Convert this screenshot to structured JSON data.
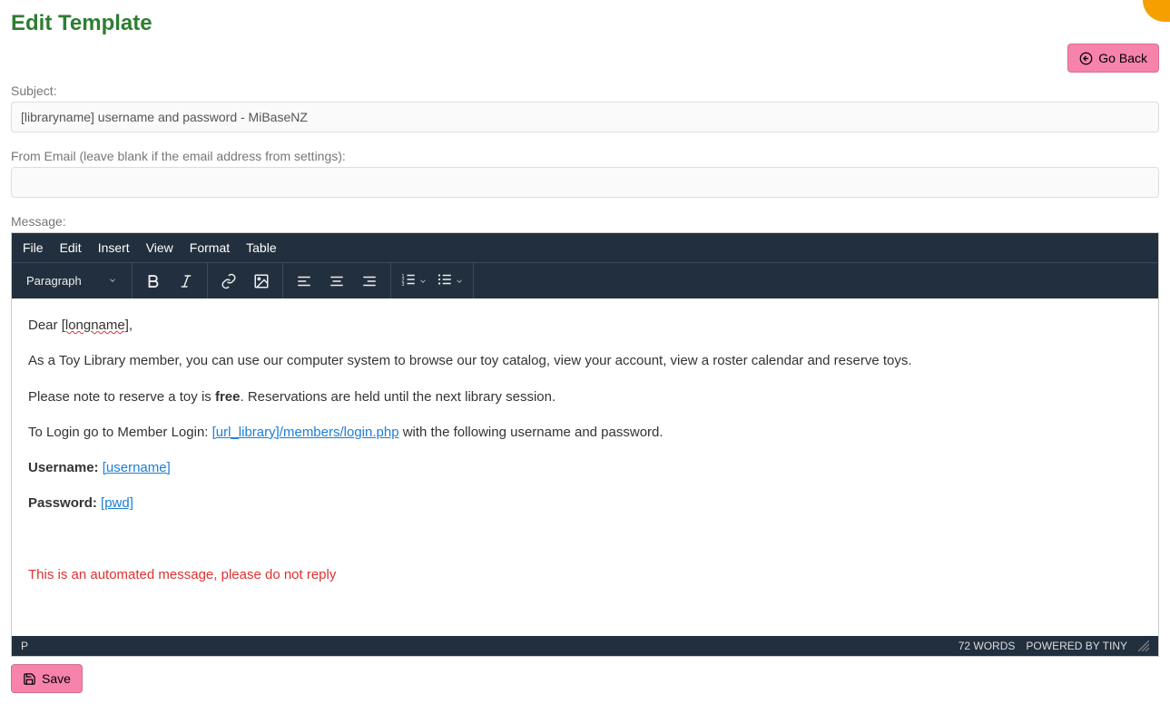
{
  "page": {
    "title": "Edit Template"
  },
  "buttons": {
    "go_back": "Go Back",
    "save": "Save"
  },
  "labels": {
    "subject": "Subject:",
    "from_email": "From Email (leave blank if the email address from settings):",
    "message": "Message:"
  },
  "fields": {
    "subject_value": "[libraryname] username and password - MiBaseNZ",
    "from_email_value": ""
  },
  "editor": {
    "menu": {
      "file": "File",
      "edit": "Edit",
      "insert": "Insert",
      "view": "View",
      "format": "Format",
      "table": "Table"
    },
    "format_select": "Paragraph",
    "status_path": "P",
    "word_count": "72 WORDS",
    "powered": "POWERED BY TINY"
  },
  "content": {
    "greeting_prefix": "Dear ",
    "greeting_token": "[longname]",
    "greeting_suffix": ",",
    "intro": "As a Toy Library member, you can use our computer system to browse our toy catalog, view your account, view a roster calendar and reserve toys.",
    "reserve_prefix": "Please note to reserve a toy is ",
    "reserve_bold": "free",
    "reserve_suffix": ". Reservations are held until the next library session.",
    "login_prefix": "To Login go to Member Login: ",
    "login_link": "[url_library]/members/login.php",
    "login_suffix": " with the following username and password.",
    "username_label": "Username:",
    "username_token": "[username]",
    "password_label": "Password:",
    "password_token": "[pwd]",
    "footer": "This is an automated message, please do not reply"
  }
}
